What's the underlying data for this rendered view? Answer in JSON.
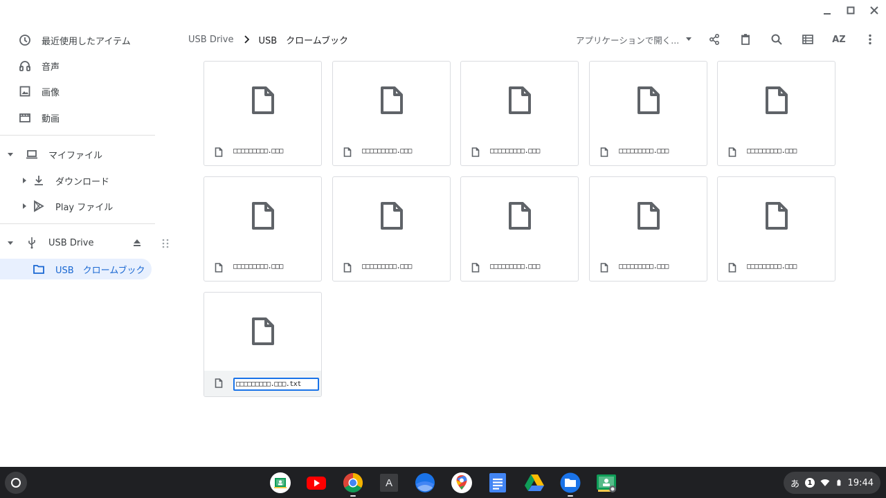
{
  "window": {
    "minimize_icon": "minimize-icon",
    "maximize_icon": "maximize-icon",
    "close_icon": "close-icon"
  },
  "sidebar": {
    "recent": "最近使用したアイテム",
    "audio": "音声",
    "images": "画像",
    "videos": "動画",
    "my_files": "マイファイル",
    "downloads": "ダウンロード",
    "play_files": "Play ファイル",
    "usb_drive": "USB Drive",
    "usb_folder": "USB　クロームブック"
  },
  "breadcrumb": {
    "root": "USB Drive",
    "current": "USB　クロームブック"
  },
  "toolbar": {
    "open_with": "アプリケーションで開く...",
    "sort_label": "AZ"
  },
  "files": [
    {
      "name": "□□□□□□□□□.□□□"
    },
    {
      "name": "□□□□□□□□□.□□□"
    },
    {
      "name": "□□□□□□□□□.□□□"
    },
    {
      "name": "□□□□□□□□□.□□□"
    },
    {
      "name": "□□□□□□□□□.□□□"
    },
    {
      "name": "□□□□□□□□□.□□□"
    },
    {
      "name": "□□□□□□□□□.□□□"
    },
    {
      "name": "□□□□□□□□□.□□□"
    },
    {
      "name": "□□□□□□□□□.□□□"
    },
    {
      "name": "□□□□□□□□□.□□□"
    }
  ],
  "editing_file": {
    "value": "□□□□□□□□□.□□□.txt"
  },
  "shelf": {
    "apps": [
      "google-classroom-icon",
      "youtube-icon",
      "chrome-icon",
      "text-app-icon",
      "google-earth-icon",
      "google-maps-icon",
      "google-docs-icon",
      "google-drive-icon",
      "files-icon",
      "screencast-icon"
    ],
    "text_app_label": "A",
    "ime": "あ",
    "notifications": "1",
    "time": "19:44"
  }
}
